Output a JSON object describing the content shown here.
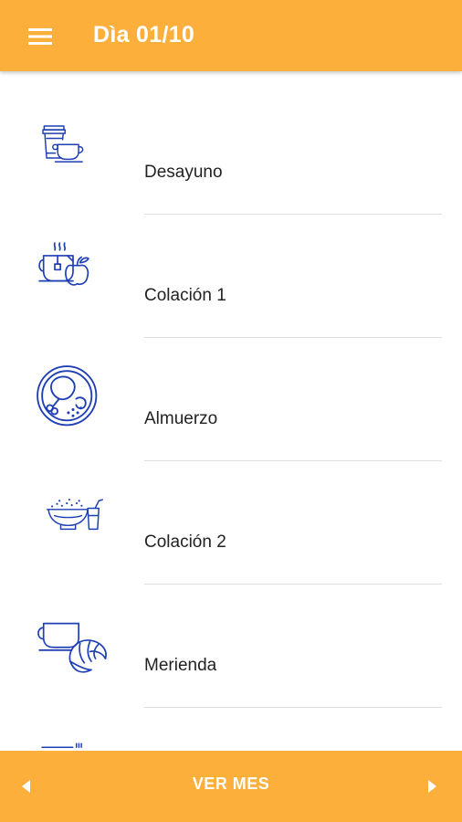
{
  "app_bar": {
    "title": "Dìa 01/10",
    "menu_icon": "hamburger-menu-icon",
    "background_color": "#FCAF3B"
  },
  "meals": [
    {
      "label": "Desayuno",
      "icon": "coffee-cup-icon"
    },
    {
      "label": "Colación 1",
      "icon": "tea-apple-icon"
    },
    {
      "label": "Almuerzo",
      "icon": "chicken-plate-icon"
    },
    {
      "label": "Colación 2",
      "icon": "cereal-bowl-juice-icon"
    },
    {
      "label": "Merienda",
      "icon": "cup-croissant-icon"
    }
  ],
  "bottom_bar": {
    "label": "VER MES",
    "prev_icon": "arrow-left-icon",
    "next_icon": "arrow-right-icon"
  },
  "colors": {
    "accent": "#FCAF3B",
    "icon_blue": "#1F3FB5",
    "text": "#222222",
    "divider": "#dedede"
  }
}
